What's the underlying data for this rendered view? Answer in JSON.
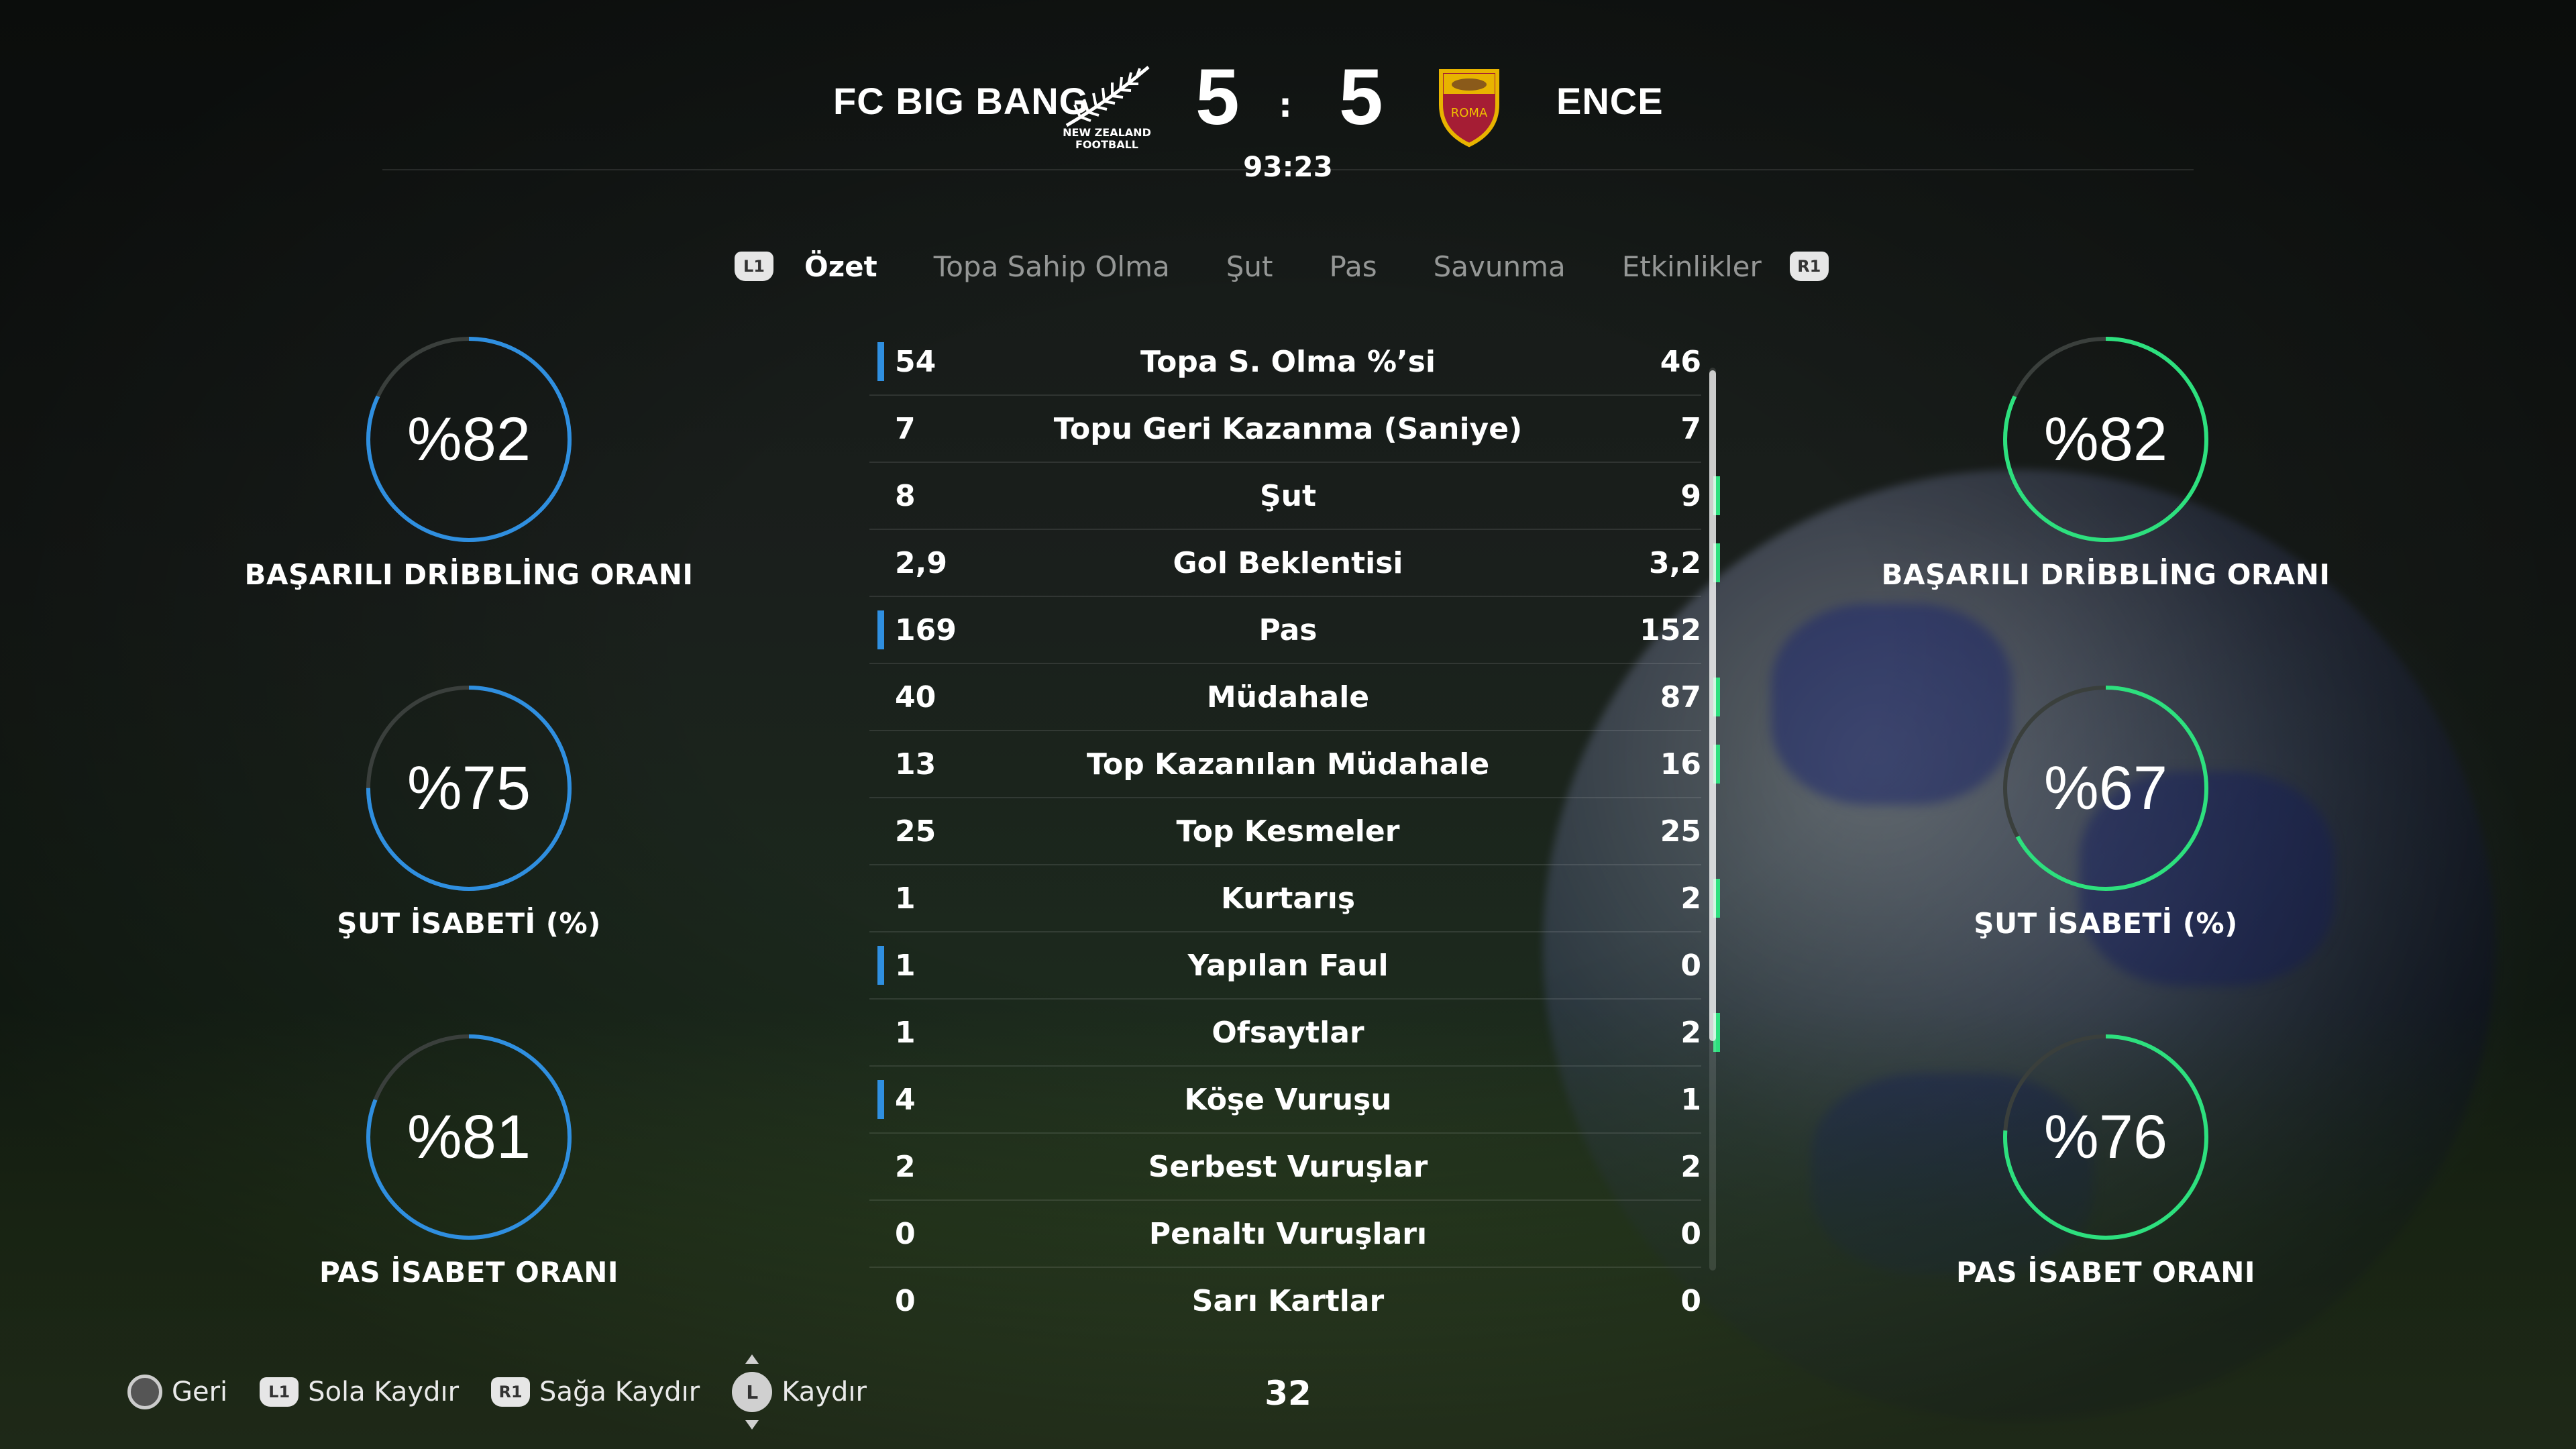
{
  "header": {
    "home_team": "FC BIG BANG",
    "away_team": "ENCE",
    "home_score": "5",
    "away_score": "5",
    "separator": ":",
    "clock": "93:23",
    "home_crest_text_1": "NEW ZEALAND",
    "home_crest_text_2": "FOOTBALL",
    "away_crest_text": "ROMA"
  },
  "tabs": {
    "left_button": "L1",
    "right_button": "R1",
    "items": [
      "Özet",
      "Topa Sahip Olma",
      "Şut",
      "Pas",
      "Savunma",
      "Etkinlikler"
    ],
    "active": "Özet"
  },
  "home_gauges": [
    {
      "value": "%82",
      "label": "BAŞARILI DRİBBLİNG ORANI",
      "fraction": 0.82
    },
    {
      "value": "%75",
      "label": "ŞUT İSABETİ (%)",
      "fraction": 0.75
    },
    {
      "value": "%81",
      "label": "PAS İSABET ORANI",
      "fraction": 0.81
    }
  ],
  "away_gauges": [
    {
      "value": "%82",
      "label": "BAŞARILI DRİBBLİNG ORANI",
      "fraction": 0.82
    },
    {
      "value": "%67",
      "label": "ŞUT İSABETİ (%)",
      "fraction": 0.67
    },
    {
      "value": "%76",
      "label": "PAS İSABET ORANI",
      "fraction": 0.76
    }
  ],
  "stats": [
    {
      "home": "54",
      "label": "Topa S. Olma %’si",
      "away": "46",
      "leader": "home"
    },
    {
      "home": "7",
      "label": "Topu Geri Kazanma (Saniye)",
      "away": "7",
      "leader": "none"
    },
    {
      "home": "8",
      "label": "Şut",
      "away": "9",
      "leader": "away"
    },
    {
      "home": "2,9",
      "label": "Gol Beklentisi",
      "away": "3,2",
      "leader": "away"
    },
    {
      "home": "169",
      "label": "Pas",
      "away": "152",
      "leader": "home"
    },
    {
      "home": "40",
      "label": "Müdahale",
      "away": "87",
      "leader": "away"
    },
    {
      "home": "13",
      "label": "Top Kazanılan Müdahale",
      "away": "16",
      "leader": "away"
    },
    {
      "home": "25",
      "label": "Top Kesmeler",
      "away": "25",
      "leader": "none"
    },
    {
      "home": "1",
      "label": "Kurtarış",
      "away": "2",
      "leader": "away"
    },
    {
      "home": "1",
      "label": "Yapılan Faul",
      "away": "0",
      "leader": "home"
    },
    {
      "home": "1",
      "label": "Ofsaytlar",
      "away": "2",
      "leader": "away"
    },
    {
      "home": "4",
      "label": "Köşe Vuruşu",
      "away": "1",
      "leader": "home"
    },
    {
      "home": "2",
      "label": "Serbest Vuruşlar",
      "away": "2",
      "leader": "none"
    },
    {
      "home": "0",
      "label": "Penaltı Vuruşları",
      "away": "0",
      "leader": "none"
    },
    {
      "home": "0",
      "label": "Sarı Kartlar",
      "away": "0",
      "leader": "none"
    }
  ],
  "footer": {
    "back_label": "Geri",
    "l1_badge": "L1",
    "scroll_left_label": "Sola Kaydır",
    "r1_badge": "R1",
    "scroll_right_label": "Sağa Kaydır",
    "stick_badge": "L",
    "scroll_label": "Kaydır",
    "page_number": "32"
  },
  "colors": {
    "home_accent": "#2f8fe0",
    "away_accent": "#2de07e",
    "gauge_track": "#3a3f3c"
  }
}
